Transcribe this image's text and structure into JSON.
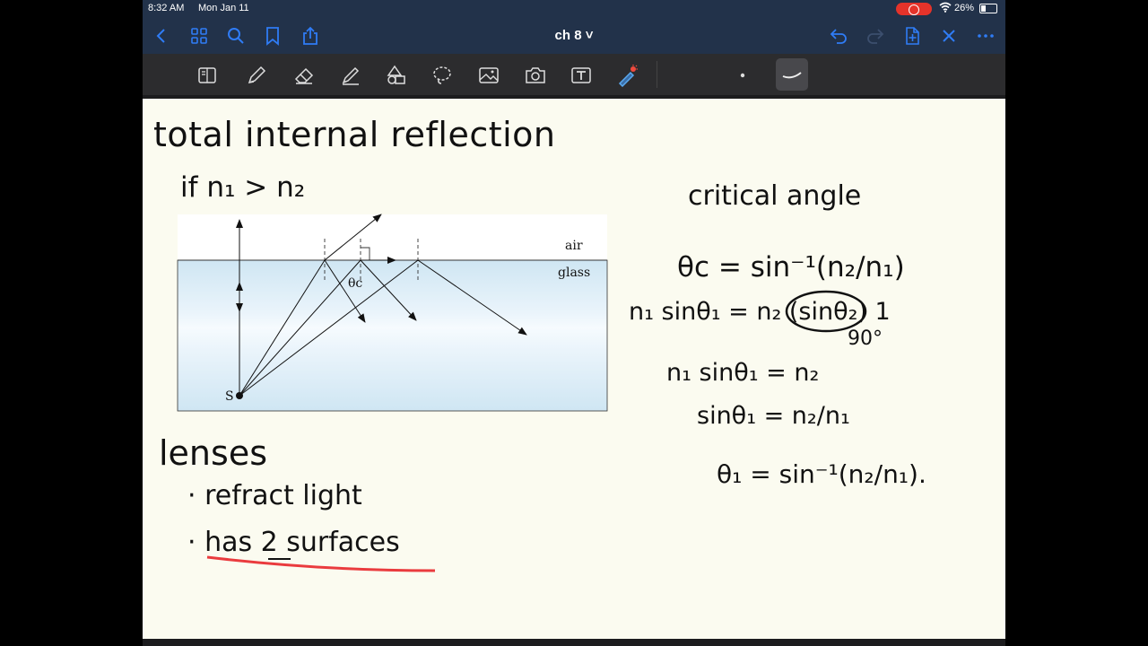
{
  "status_bar": {
    "time": "8:32 AM",
    "date": "Mon Jan 11",
    "battery": "26%"
  },
  "navbar": {
    "title": "ch 8 ˅"
  },
  "toolbar": {
    "tools": [
      "read-mode-icon",
      "pen-icon",
      "eraser-icon",
      "highlighter-icon",
      "shapes-icon",
      "lasso-icon",
      "image-icon",
      "camera-icon",
      "text-icon",
      "laser-pointer-icon"
    ],
    "pen_sizes": [
      "dot",
      "curve"
    ]
  },
  "note": {
    "heading": "total internal reflection",
    "condition": "if n₁ > n₂",
    "figure": {
      "label_air": "air",
      "label_glass": "glass",
      "label_theta": "θc",
      "label_source": "S"
    },
    "critical_heading": "critical angle",
    "eq1": "θc = sin⁻¹(n₂/n₁)",
    "eq2": "n₁ sinθ₁ = n₂ (sinθ₂) 1",
    "eq2_note": "90°",
    "eq3": "n₁ sinθ₁ = n₂",
    "eq4": "sinθ₁ = n₂/n₁",
    "eq5": "θ₁ = sin⁻¹(n₂/n₁).",
    "lenses_heading": "lenses",
    "bullet1": "· refract light",
    "bullet2": "· has 2 surfaces"
  },
  "colors": {
    "navbar": "#22324a",
    "accent": "#2f7cf6",
    "page": "#fbfbf0",
    "glass_top": "#cfe6f3",
    "underline": "#e8262a"
  }
}
